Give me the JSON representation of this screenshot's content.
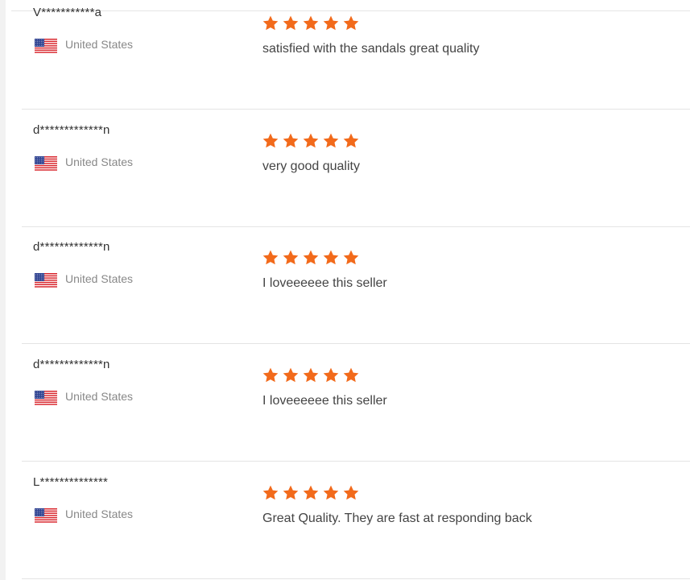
{
  "theme": {
    "star_color": "#f26a1b",
    "divider_color": "#e4e4e4",
    "name_color": "#333333",
    "country_color": "#888888",
    "text_color": "#444444"
  },
  "reviews": [
    {
      "buyer": "V***********a",
      "country": "United States",
      "flag_icon": "us-flag-icon",
      "rating": 5,
      "max_rating": 5,
      "text": "satisfied with the sandals great quality"
    },
    {
      "buyer": "d*************n",
      "country": "United States",
      "flag_icon": "us-flag-icon",
      "rating": 5,
      "max_rating": 5,
      "text": "very good quality"
    },
    {
      "buyer": "d*************n",
      "country": "United States",
      "flag_icon": "us-flag-icon",
      "rating": 5,
      "max_rating": 5,
      "text": "I loveeeeee this seller"
    },
    {
      "buyer": "d*************n",
      "country": "United States",
      "flag_icon": "us-flag-icon",
      "rating": 5,
      "max_rating": 5,
      "text": "I loveeeeee this seller"
    },
    {
      "buyer": "L**************",
      "country": "United States",
      "flag_icon": "us-flag-icon",
      "rating": 5,
      "max_rating": 5,
      "text": "Great Quality.  They are fast at responding back"
    }
  ]
}
